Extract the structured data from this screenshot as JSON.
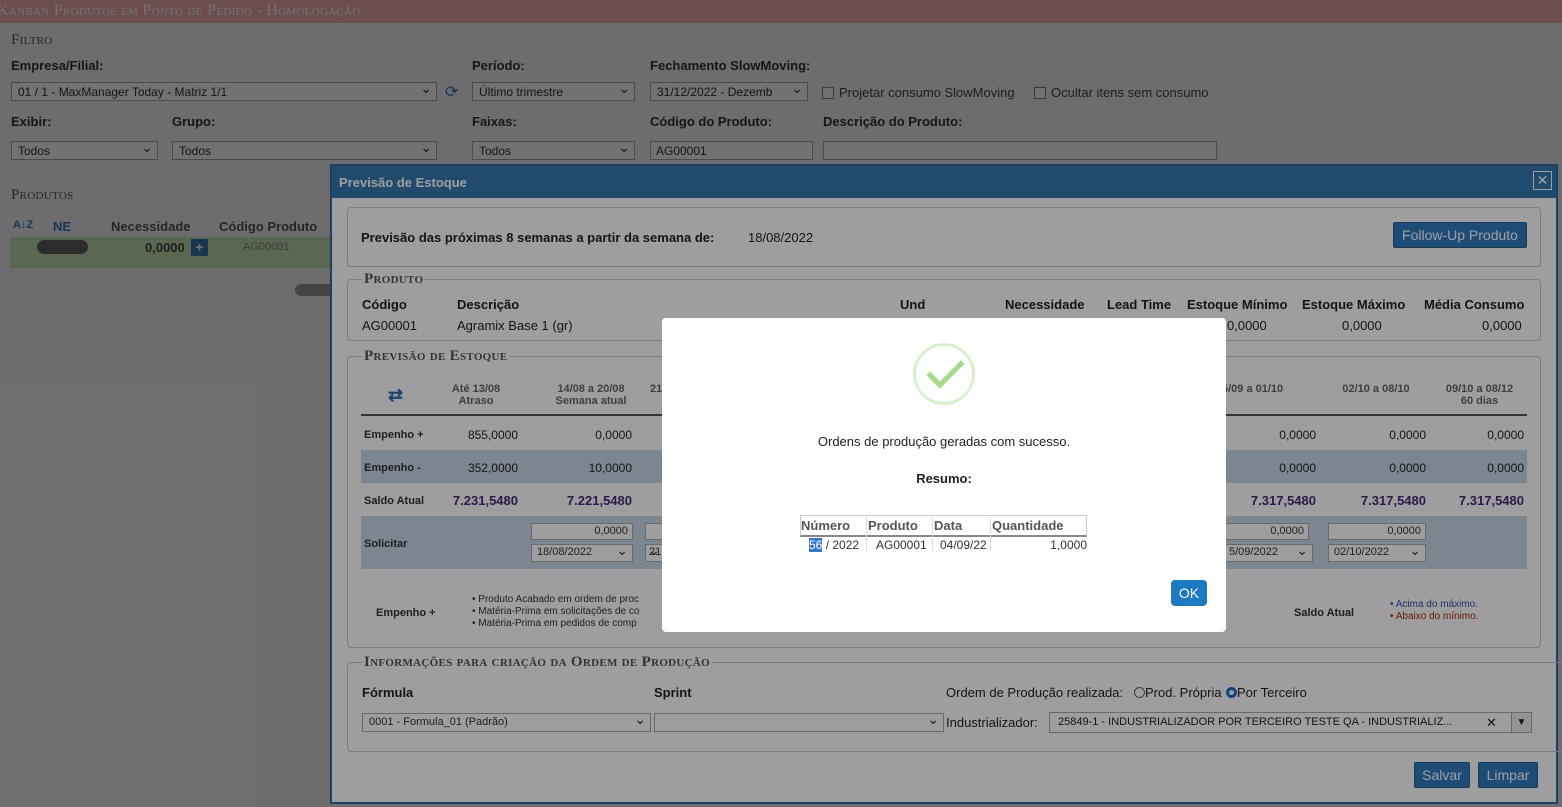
{
  "app_title": "Kanban Produtos em Ponto de Pedido  - Homologação",
  "filtro": {
    "legend": "Filtro",
    "empresa_label": "Empresa/Filial:",
    "empresa_value": "01 / 1 - MaxManager Today - Matriz 1/1",
    "periodo_label": "Período:",
    "periodo_value": "Último trimestre",
    "fechamento_label": "Fechamento SlowMoving:",
    "fechamento_value": "31/12/2022 - Dezemb",
    "projetar_label": "Projetar consumo SlowMoving",
    "ocultar_label": "Ocultar itens sem consumo",
    "exibir_label": "Exibir:",
    "exibir_value": "Todos",
    "grupo_label": "Grupo:",
    "grupo_value": "Todos",
    "faixas_label": "Faixas:",
    "faixas_value": "Todos",
    "codigo_label": "Código do Produto:",
    "codigo_value": "AG00001",
    "descricao_label": "Descrição do Produto:",
    "descricao_value": ""
  },
  "produtos": {
    "legend": "Produtos",
    "col_ne": "NE",
    "col_nec": "Necessidade",
    "col_cod": "Código Produto",
    "row_nec": "0,0000",
    "row_cod": "AG00001"
  },
  "modal": {
    "title": "Previsão de Estoque",
    "close": "✕",
    "previsao_label": "Previsão das próximas 8 semanas a partir da semana de:",
    "previsao_date": "18/08/2022",
    "followup_btn": "Follow-Up Produto",
    "produto_legend": "Produto",
    "produto_headers": [
      "Código",
      "Descrição",
      "Und",
      "Necessidade",
      "Lead Time",
      "Estoque Mínimo",
      "Estoque Máximo",
      "Média Consumo"
    ],
    "produto_values": {
      "codigo": "AG00001",
      "descricao": "Agramix Base 1 (gr)",
      "min": "0,0000",
      "max": "0,0000",
      "media": "0,0000"
    },
    "previsao_legend": "Previsão de Estoque",
    "col_heads": [
      {
        "l1": "Até 13/08",
        "l2": "Atraso"
      },
      {
        "l1": "14/08 a 20/08",
        "l2": "Semana atual"
      },
      {
        "l1": "21",
        "l2": ""
      },
      {
        "l1": "5/09 a 01/10",
        "l2": ""
      },
      {
        "l1": "02/10 a 08/10",
        "l2": ""
      },
      {
        "l1": "09/10 a 08/12",
        "l2": "60 dias"
      }
    ],
    "rows": {
      "empenho_mais": {
        "label": "Empenho +",
        "vals": [
          "855,0000",
          "0,0000",
          "0,0000",
          "0,0000",
          "0,0000"
        ]
      },
      "empenho_menos": {
        "label": "Empenho -",
        "vals": [
          "352,0000",
          "10,0000",
          "0,0000",
          "0,0000",
          "0,0000"
        ]
      },
      "saldo": {
        "label": "Saldo Atual",
        "vals": [
          "7.231,5480",
          "7.221,5480",
          "7.317,5480",
          "7.317,5480",
          "7.317,5480"
        ]
      },
      "solicitar": {
        "label": "Solicitar",
        "qty": "0,0000",
        "d1": "18/08/2022",
        "d2": "21",
        "d3": "5/09/2022",
        "d4": "02/10/2022"
      }
    },
    "legend_empenho": "Empenho +",
    "legend_bullets": [
      "Produto Acabado em ordem de proc",
      "Matéria-Prima em solicitações de co",
      "Matéria-Prima em pedidos de comp"
    ],
    "legend_saldo": "Saldo Atual",
    "legend_saldo_bullets": [
      "Acima do máximo.",
      "Abaixo do mínimo."
    ],
    "info_legend": "Informações para criação da Ordem de Produção",
    "formula_label": "Fórmula",
    "formula_value": "0001 - Formula_01 (Padrão)",
    "sprint_label": "Sprint",
    "sprint_value": "",
    "op_label": "Ordem de Produção realizada:",
    "op_opt1": "Prod. Própria",
    "op_opt2": "Por Terceiro",
    "industrializador_label": "Industrializador:",
    "industrializador_value": "25849-1 - INDUSTRIALIZADOR POR TERCEIRO TESTE QA - INDUSTRIALIZ...",
    "salvar": "Salvar",
    "limpar": "Limpar"
  },
  "dialog": {
    "message": "Ordens de produção geradas com sucesso.",
    "resumo": "Resumo:",
    "headers": [
      "Número",
      "Produto",
      "Data",
      "Quantidade"
    ],
    "row": {
      "numero_sel": "56",
      "numero_rest": "/ 2022",
      "produto": "AG00001",
      "data": "04/09/22",
      "quantidade": "1,0000"
    },
    "ok": "OK"
  },
  "colors": {
    "accent": "#3579b1",
    "button": "#2f7cbf",
    "title_bar": "#f0b0ae",
    "success": "#a5dc86",
    "saldo_text": "#4a2a78"
  }
}
